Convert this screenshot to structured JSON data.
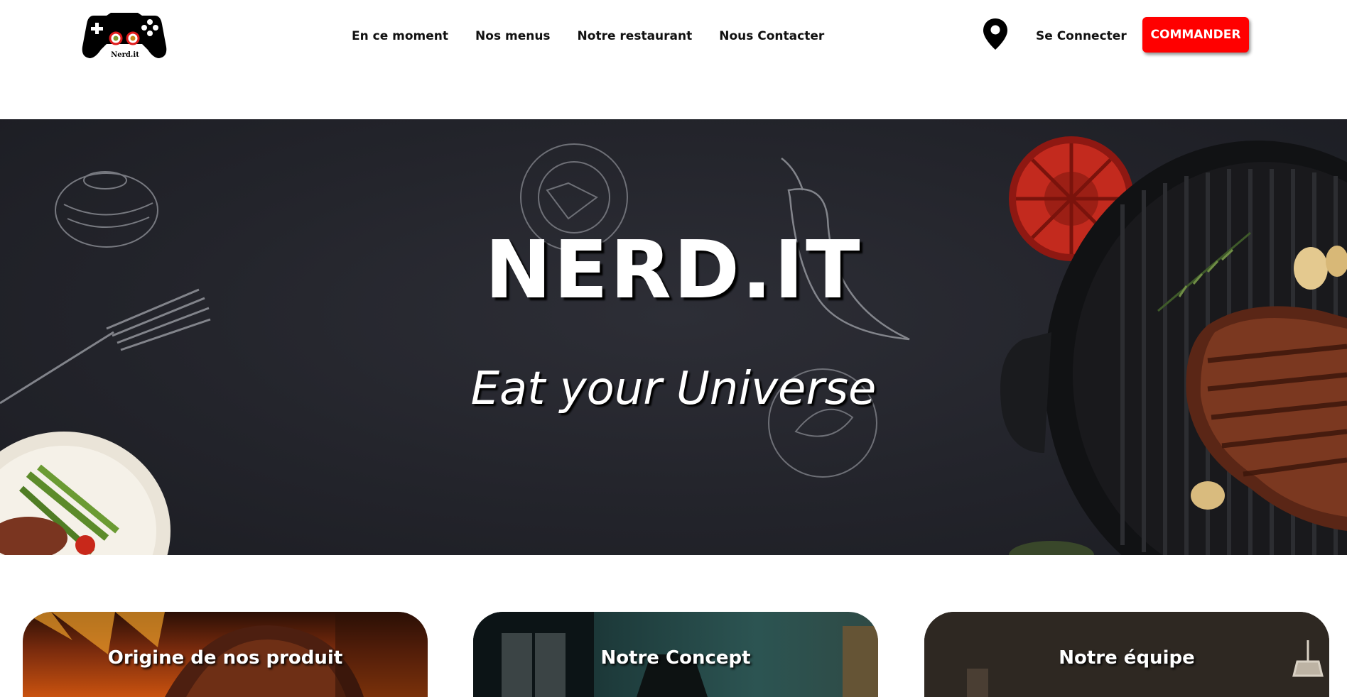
{
  "header": {
    "logo_text": "Nerd.it",
    "nav": [
      {
        "label": "En ce moment"
      },
      {
        "label": "Nos menus"
      },
      {
        "label": "Notre restaurant"
      },
      {
        "label": "Nous Contacter"
      }
    ],
    "location_icon": "map-pin-icon",
    "login_label": "Se Connecter",
    "order_label": "COMMANDER"
  },
  "hero": {
    "title": "NERD.IT",
    "subtitle": "Eat your Universe"
  },
  "cards": [
    {
      "title": "Origine de nos produit"
    },
    {
      "title": "Notre Concept"
    },
    {
      "title": "Notre équipe"
    }
  ],
  "colors": {
    "accent": "#ff0000",
    "hero_background": "#25262d",
    "text": "#111111"
  }
}
